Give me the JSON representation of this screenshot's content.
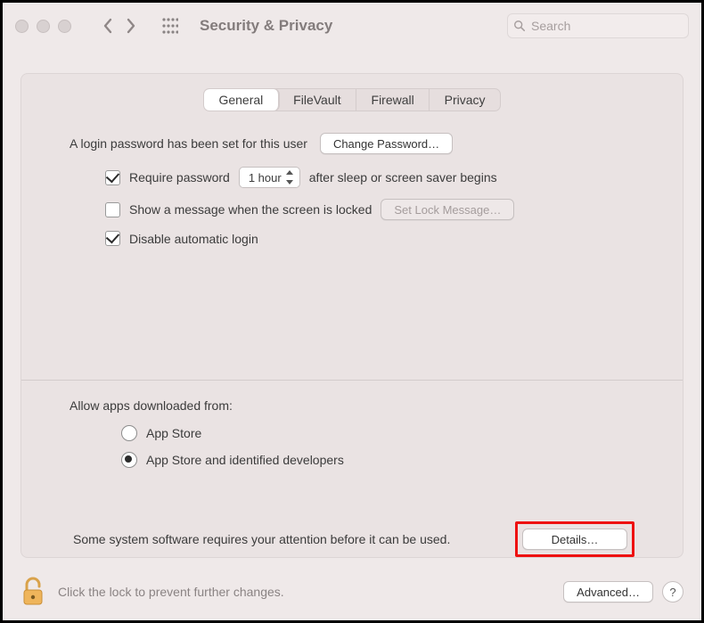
{
  "header": {
    "title": "Security & Privacy",
    "search_placeholder": "Search"
  },
  "tabs": [
    "General",
    "FileVault",
    "Firewall",
    "Privacy"
  ],
  "active_tab": 0,
  "login": {
    "intro": "A login password has been set for this user",
    "change_password_label": "Change Password…",
    "require_password_checked": true,
    "require_password_label_before": "Require password",
    "require_password_delay": "1 hour",
    "require_password_label_after": "after sleep or screen saver begins",
    "show_message_checked": false,
    "show_message_label": "Show a message when the screen is locked",
    "set_lock_message_label": "Set Lock Message…",
    "disable_auto_login_checked": true,
    "disable_auto_login_label": "Disable automatic login"
  },
  "download": {
    "heading": "Allow apps downloaded from:",
    "options": [
      "App Store",
      "App Store and identified developers"
    ],
    "selected": 1
  },
  "notice": {
    "text": "Some system software requires your attention before it can be used.",
    "details_label": "Details…"
  },
  "footer": {
    "lock_text": "Click the lock to prevent further changes.",
    "advanced_label": "Advanced…",
    "help_label": "?"
  }
}
